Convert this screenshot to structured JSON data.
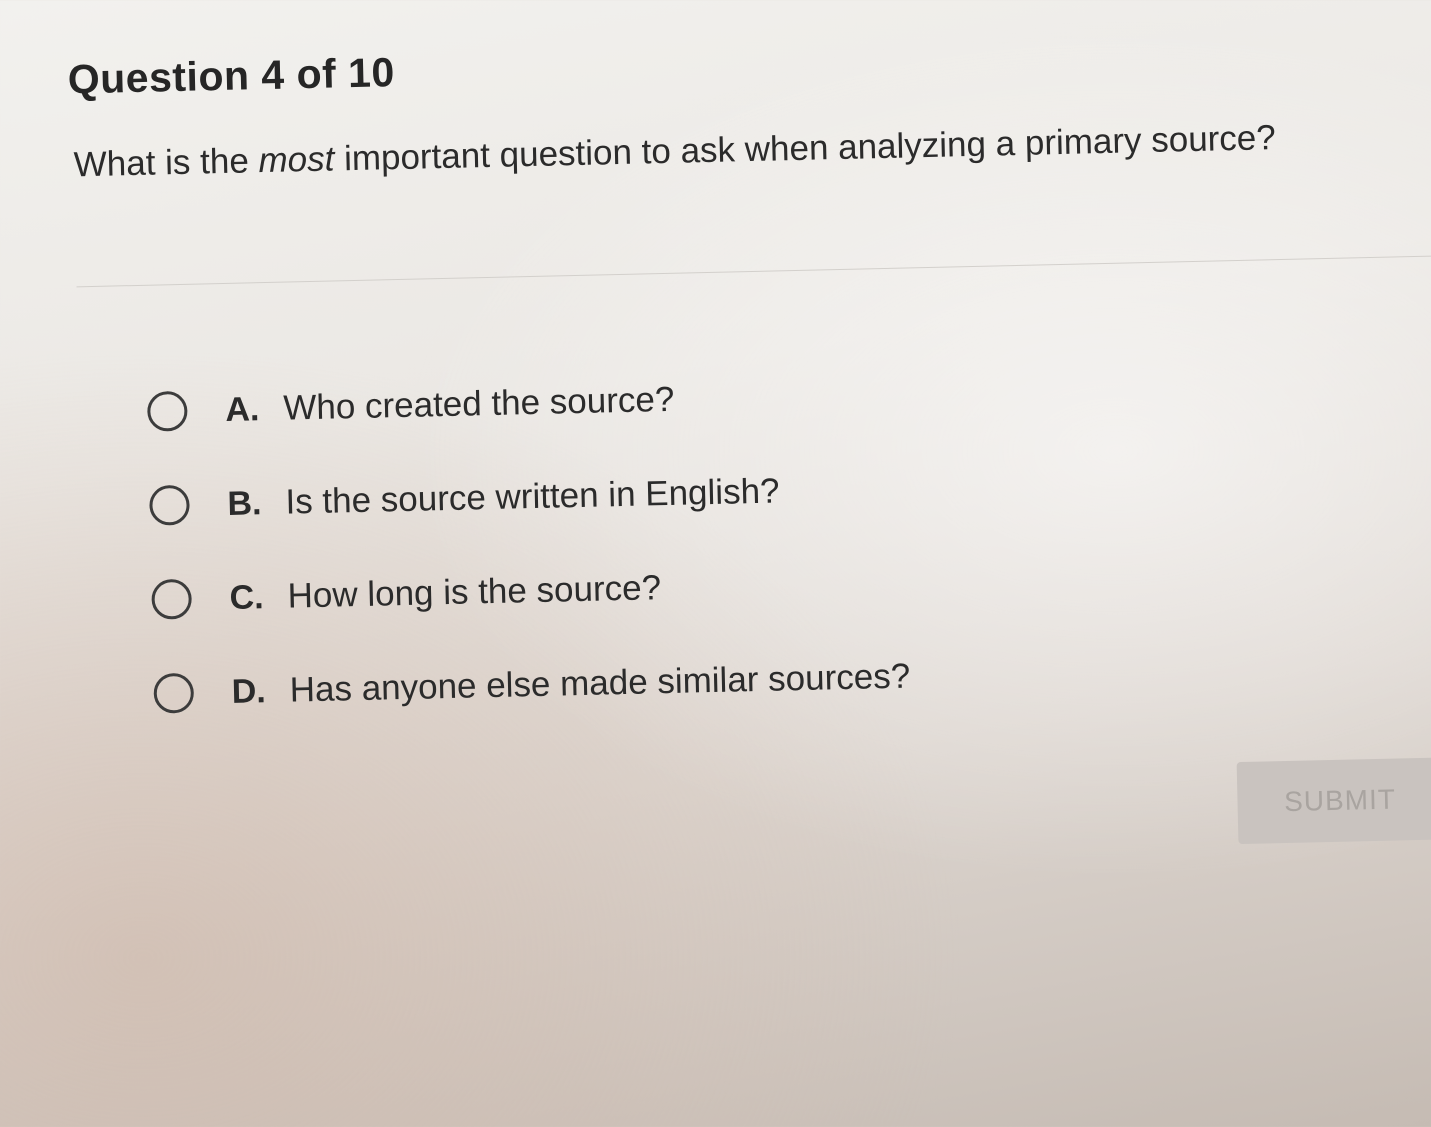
{
  "question": {
    "number_label": "Question 4 of 10",
    "text_before": "What is the ",
    "text_emphasis": "most",
    "text_after": " important question to ask when analyzing a primary source?"
  },
  "options": [
    {
      "letter": "A.",
      "text": "Who created the source?"
    },
    {
      "letter": "B.",
      "text": "Is the source written in English?"
    },
    {
      "letter": "C.",
      "text": "How long is the source?"
    },
    {
      "letter": "D.",
      "text": "Has anyone else made similar sources?"
    }
  ],
  "submit": {
    "label": "SUBMIT",
    "state": "disabled"
  }
}
